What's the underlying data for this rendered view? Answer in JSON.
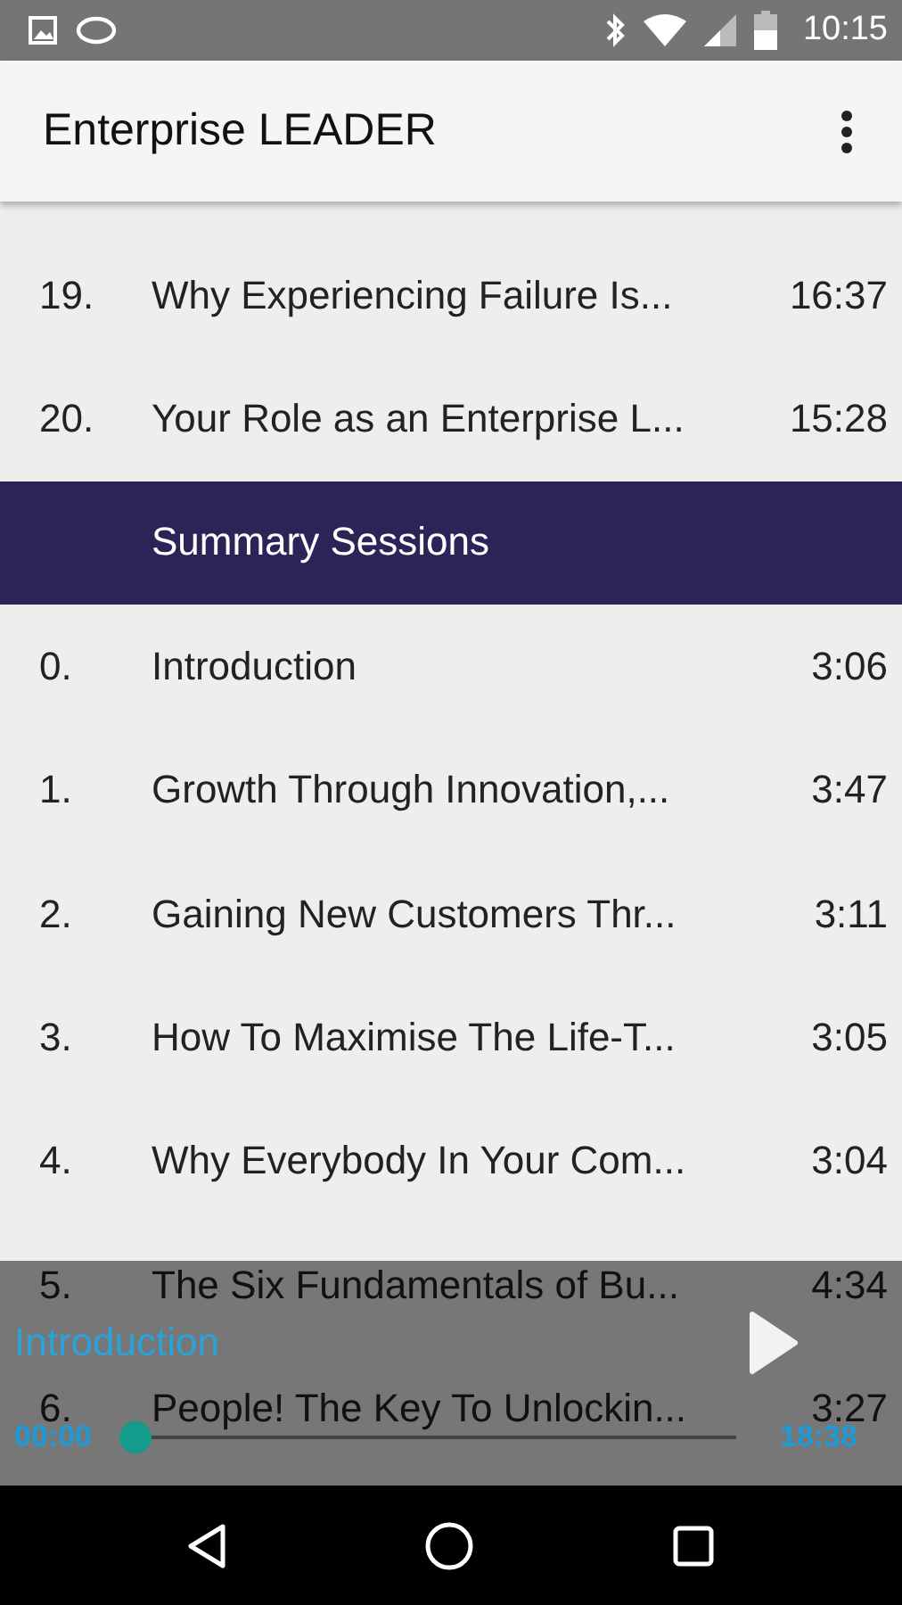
{
  "status_bar": {
    "time": "10:15"
  },
  "app_bar": {
    "title": "Enterprise LEADER"
  },
  "list": [
    {
      "kind": "track",
      "number": "19.",
      "title": "Why Experiencing Failure Is...",
      "duration": "16:37"
    },
    {
      "kind": "track",
      "number": "20.",
      "title": "Your Role as an Enterprise L...",
      "duration": "15:28"
    },
    {
      "kind": "header",
      "title": "Summary Sessions"
    },
    {
      "kind": "track",
      "number": "0.",
      "title": "Introduction",
      "duration": "3:06"
    },
    {
      "kind": "track",
      "number": "1.",
      "title": "Growth Through Innovation,...",
      "duration": "3:47"
    },
    {
      "kind": "track",
      "number": "2.",
      "title": "Gaining New Customers Thr...",
      "duration": "3:11"
    },
    {
      "kind": "track",
      "number": "3.",
      "title": "How To Maximise The Life-T...",
      "duration": "3:05"
    },
    {
      "kind": "track",
      "number": "4.",
      "title": "Why Everybody In Your Com...",
      "duration": "3:04"
    },
    {
      "kind": "track",
      "number": "5.",
      "title": "The Six Fundamentals of Bu...",
      "duration": "4:34"
    },
    {
      "kind": "track",
      "number": "6.",
      "title": "People! The Key To Unlockin...",
      "duration": "3:27"
    }
  ],
  "player": {
    "title": "Introduction",
    "elapsed": "00:00",
    "total": "18:38",
    "level": 0
  }
}
